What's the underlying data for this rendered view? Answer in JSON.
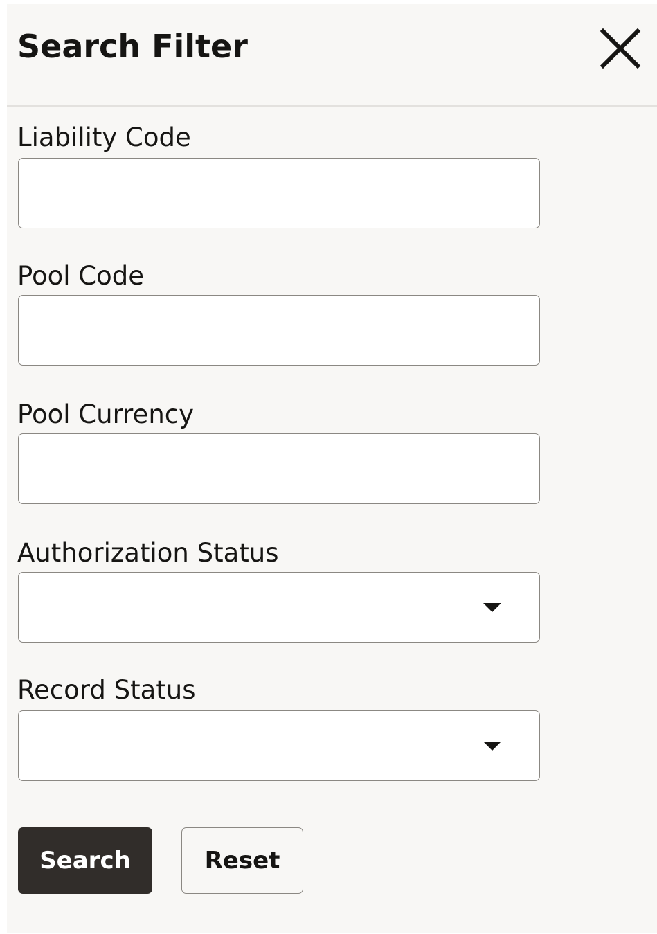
{
  "panel": {
    "title": "Search Filter",
    "close_icon": "close-icon"
  },
  "fields": {
    "liability_code": {
      "label": "Liability Code",
      "value": "",
      "placeholder": ""
    },
    "pool_code": {
      "label": "Pool Code",
      "value": "",
      "placeholder": ""
    },
    "pool_currency": {
      "label": "Pool Currency",
      "value": "",
      "placeholder": ""
    },
    "authorization_status": {
      "label": "Authorization Status",
      "selected": "",
      "icon": "chevron-down-icon"
    },
    "record_status": {
      "label": "Record Status",
      "selected": "",
      "icon": "chevron-down-icon"
    }
  },
  "actions": {
    "search_label": "Search",
    "reset_label": "Reset"
  },
  "colors": {
    "panel_background": "#f8f7f5",
    "primary_button": "#312d2a",
    "text": "#161513",
    "border": "#8b8883"
  }
}
